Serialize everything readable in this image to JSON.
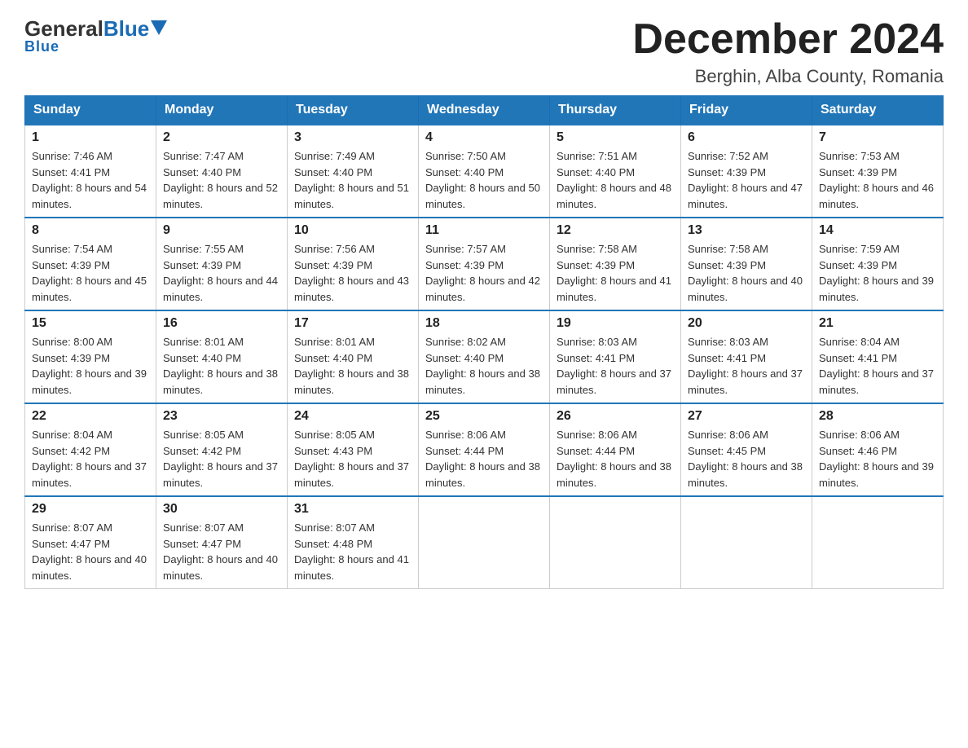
{
  "header": {
    "logo_general": "General",
    "logo_blue": "Blue",
    "month_title": "December 2024",
    "location": "Berghin, Alba County, Romania"
  },
  "days_of_week": [
    "Sunday",
    "Monday",
    "Tuesday",
    "Wednesday",
    "Thursday",
    "Friday",
    "Saturday"
  ],
  "weeks": [
    [
      {
        "day": "1",
        "sunrise": "7:46 AM",
        "sunset": "4:41 PM",
        "daylight": "8 hours and 54 minutes."
      },
      {
        "day": "2",
        "sunrise": "7:47 AM",
        "sunset": "4:40 PM",
        "daylight": "8 hours and 52 minutes."
      },
      {
        "day": "3",
        "sunrise": "7:49 AM",
        "sunset": "4:40 PM",
        "daylight": "8 hours and 51 minutes."
      },
      {
        "day": "4",
        "sunrise": "7:50 AM",
        "sunset": "4:40 PM",
        "daylight": "8 hours and 50 minutes."
      },
      {
        "day": "5",
        "sunrise": "7:51 AM",
        "sunset": "4:40 PM",
        "daylight": "8 hours and 48 minutes."
      },
      {
        "day": "6",
        "sunrise": "7:52 AM",
        "sunset": "4:39 PM",
        "daylight": "8 hours and 47 minutes."
      },
      {
        "day": "7",
        "sunrise": "7:53 AM",
        "sunset": "4:39 PM",
        "daylight": "8 hours and 46 minutes."
      }
    ],
    [
      {
        "day": "8",
        "sunrise": "7:54 AM",
        "sunset": "4:39 PM",
        "daylight": "8 hours and 45 minutes."
      },
      {
        "day": "9",
        "sunrise": "7:55 AM",
        "sunset": "4:39 PM",
        "daylight": "8 hours and 44 minutes."
      },
      {
        "day": "10",
        "sunrise": "7:56 AM",
        "sunset": "4:39 PM",
        "daylight": "8 hours and 43 minutes."
      },
      {
        "day": "11",
        "sunrise": "7:57 AM",
        "sunset": "4:39 PM",
        "daylight": "8 hours and 42 minutes."
      },
      {
        "day": "12",
        "sunrise": "7:58 AM",
        "sunset": "4:39 PM",
        "daylight": "8 hours and 41 minutes."
      },
      {
        "day": "13",
        "sunrise": "7:58 AM",
        "sunset": "4:39 PM",
        "daylight": "8 hours and 40 minutes."
      },
      {
        "day": "14",
        "sunrise": "7:59 AM",
        "sunset": "4:39 PM",
        "daylight": "8 hours and 39 minutes."
      }
    ],
    [
      {
        "day": "15",
        "sunrise": "8:00 AM",
        "sunset": "4:39 PM",
        "daylight": "8 hours and 39 minutes."
      },
      {
        "day": "16",
        "sunrise": "8:01 AM",
        "sunset": "4:40 PM",
        "daylight": "8 hours and 38 minutes."
      },
      {
        "day": "17",
        "sunrise": "8:01 AM",
        "sunset": "4:40 PM",
        "daylight": "8 hours and 38 minutes."
      },
      {
        "day": "18",
        "sunrise": "8:02 AM",
        "sunset": "4:40 PM",
        "daylight": "8 hours and 38 minutes."
      },
      {
        "day": "19",
        "sunrise": "8:03 AM",
        "sunset": "4:41 PM",
        "daylight": "8 hours and 37 minutes."
      },
      {
        "day": "20",
        "sunrise": "8:03 AM",
        "sunset": "4:41 PM",
        "daylight": "8 hours and 37 minutes."
      },
      {
        "day": "21",
        "sunrise": "8:04 AM",
        "sunset": "4:41 PM",
        "daylight": "8 hours and 37 minutes."
      }
    ],
    [
      {
        "day": "22",
        "sunrise": "8:04 AM",
        "sunset": "4:42 PM",
        "daylight": "8 hours and 37 minutes."
      },
      {
        "day": "23",
        "sunrise": "8:05 AM",
        "sunset": "4:42 PM",
        "daylight": "8 hours and 37 minutes."
      },
      {
        "day": "24",
        "sunrise": "8:05 AM",
        "sunset": "4:43 PM",
        "daylight": "8 hours and 37 minutes."
      },
      {
        "day": "25",
        "sunrise": "8:06 AM",
        "sunset": "4:44 PM",
        "daylight": "8 hours and 38 minutes."
      },
      {
        "day": "26",
        "sunrise": "8:06 AM",
        "sunset": "4:44 PM",
        "daylight": "8 hours and 38 minutes."
      },
      {
        "day": "27",
        "sunrise": "8:06 AM",
        "sunset": "4:45 PM",
        "daylight": "8 hours and 38 minutes."
      },
      {
        "day": "28",
        "sunrise": "8:06 AM",
        "sunset": "4:46 PM",
        "daylight": "8 hours and 39 minutes."
      }
    ],
    [
      {
        "day": "29",
        "sunrise": "8:07 AM",
        "sunset": "4:47 PM",
        "daylight": "8 hours and 40 minutes."
      },
      {
        "day": "30",
        "sunrise": "8:07 AM",
        "sunset": "4:47 PM",
        "daylight": "8 hours and 40 minutes."
      },
      {
        "day": "31",
        "sunrise": "8:07 AM",
        "sunset": "4:48 PM",
        "daylight": "8 hours and 41 minutes."
      },
      null,
      null,
      null,
      null
    ]
  ]
}
